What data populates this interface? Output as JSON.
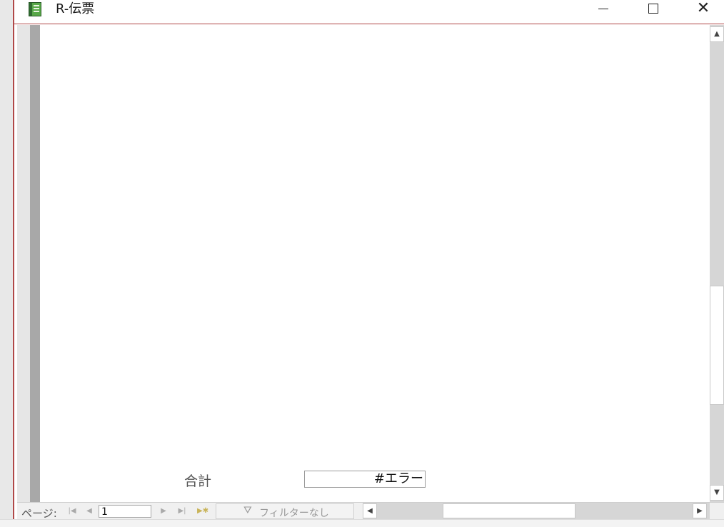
{
  "window": {
    "title": "R-伝票",
    "min_icon": "minimize-icon",
    "max_icon": "maximize-icon",
    "close_glyph": "✕"
  },
  "report": {
    "total_label": "合計",
    "total_value": "#エラー"
  },
  "navigation": {
    "page_label": "ページ:",
    "first_glyph": "|◀",
    "prev_glyph": "◀",
    "page_value": "1",
    "next_glyph": "▶",
    "last_glyph": "▶|",
    "new_glyph": "▶✱",
    "filter_label": "フィルターなし",
    "filter_icon": "funnel-icon"
  },
  "scrollbars": {
    "up_glyph": "▲",
    "down_glyph": "▼",
    "left_glyph": "◀",
    "right_glyph": "▶"
  }
}
